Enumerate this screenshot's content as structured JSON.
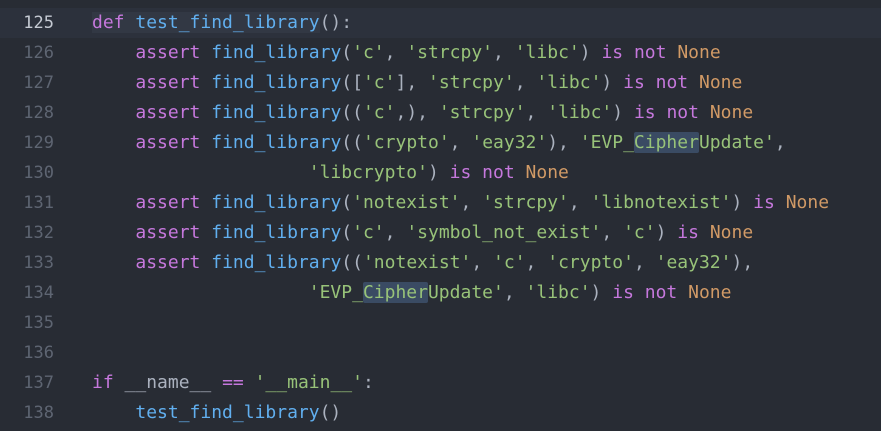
{
  "editor": {
    "lines": [
      {
        "number": "125",
        "tokens": [
          {
            "t": "def",
            "c": "kw"
          },
          {
            "t": " ",
            "c": "plain"
          },
          {
            "t": "test_find_library",
            "c": "fn"
          },
          {
            "t": "():",
            "c": "plain"
          }
        ]
      },
      {
        "number": "126",
        "tokens": [
          {
            "t": "    ",
            "c": "plain"
          },
          {
            "t": "assert",
            "c": "kw"
          },
          {
            "t": " ",
            "c": "plain"
          },
          {
            "t": "find_library",
            "c": "fn"
          },
          {
            "t": "(",
            "c": "plain"
          },
          {
            "t": "'c'",
            "c": "str"
          },
          {
            "t": ", ",
            "c": "plain"
          },
          {
            "t": "'strcpy'",
            "c": "str"
          },
          {
            "t": ", ",
            "c": "plain"
          },
          {
            "t": "'libc'",
            "c": "str"
          },
          {
            "t": ") ",
            "c": "plain"
          },
          {
            "t": "is not",
            "c": "kw"
          },
          {
            "t": " ",
            "c": "plain"
          },
          {
            "t": "None",
            "c": "const"
          }
        ]
      },
      {
        "number": "127",
        "tokens": [
          {
            "t": "    ",
            "c": "plain"
          },
          {
            "t": "assert",
            "c": "kw"
          },
          {
            "t": " ",
            "c": "plain"
          },
          {
            "t": "find_library",
            "c": "fn"
          },
          {
            "t": "([",
            "c": "plain"
          },
          {
            "t": "'c'",
            "c": "str"
          },
          {
            "t": "], ",
            "c": "plain"
          },
          {
            "t": "'strcpy'",
            "c": "str"
          },
          {
            "t": ", ",
            "c": "plain"
          },
          {
            "t": "'libc'",
            "c": "str"
          },
          {
            "t": ") ",
            "c": "plain"
          },
          {
            "t": "is not",
            "c": "kw"
          },
          {
            "t": " ",
            "c": "plain"
          },
          {
            "t": "None",
            "c": "const"
          }
        ]
      },
      {
        "number": "128",
        "tokens": [
          {
            "t": "    ",
            "c": "plain"
          },
          {
            "t": "assert",
            "c": "kw"
          },
          {
            "t": " ",
            "c": "plain"
          },
          {
            "t": "find_library",
            "c": "fn"
          },
          {
            "t": "((",
            "c": "plain"
          },
          {
            "t": "'c'",
            "c": "str"
          },
          {
            "t": ",), ",
            "c": "plain"
          },
          {
            "t": "'strcpy'",
            "c": "str"
          },
          {
            "t": ", ",
            "c": "plain"
          },
          {
            "t": "'libc'",
            "c": "str"
          },
          {
            "t": ") ",
            "c": "plain"
          },
          {
            "t": "is not",
            "c": "kw"
          },
          {
            "t": " ",
            "c": "plain"
          },
          {
            "t": "None",
            "c": "const"
          }
        ]
      },
      {
        "number": "129",
        "tokens": [
          {
            "t": "    ",
            "c": "plain"
          },
          {
            "t": "assert",
            "c": "kw"
          },
          {
            "t": " ",
            "c": "plain"
          },
          {
            "t": "find_library",
            "c": "fn"
          },
          {
            "t": "((",
            "c": "plain"
          },
          {
            "t": "'crypto'",
            "c": "str"
          },
          {
            "t": ", ",
            "c": "plain"
          },
          {
            "t": "'eay32'",
            "c": "str"
          },
          {
            "t": "), ",
            "c": "plain"
          },
          {
            "t": "'EVP_",
            "c": "str"
          },
          {
            "t": "Cipher",
            "c": "str",
            "sel": true
          },
          {
            "t": "Update'",
            "c": "str"
          },
          {
            "t": ",",
            "c": "plain"
          }
        ]
      },
      {
        "number": "130",
        "tokens": [
          {
            "t": "                    ",
            "c": "plain"
          },
          {
            "t": "'libcrypto'",
            "c": "str"
          },
          {
            "t": ") ",
            "c": "plain"
          },
          {
            "t": "is not",
            "c": "kw"
          },
          {
            "t": " ",
            "c": "plain"
          },
          {
            "t": "None",
            "c": "const"
          }
        ]
      },
      {
        "number": "131",
        "tokens": [
          {
            "t": "    ",
            "c": "plain"
          },
          {
            "t": "assert",
            "c": "kw"
          },
          {
            "t": " ",
            "c": "plain"
          },
          {
            "t": "find_library",
            "c": "fn"
          },
          {
            "t": "(",
            "c": "plain"
          },
          {
            "t": "'notexist'",
            "c": "str"
          },
          {
            "t": ", ",
            "c": "plain"
          },
          {
            "t": "'strcpy'",
            "c": "str"
          },
          {
            "t": ", ",
            "c": "plain"
          },
          {
            "t": "'libnotexist'",
            "c": "str"
          },
          {
            "t": ") ",
            "c": "plain"
          },
          {
            "t": "is",
            "c": "kw"
          },
          {
            "t": " ",
            "c": "plain"
          },
          {
            "t": "None",
            "c": "const"
          }
        ]
      },
      {
        "number": "132",
        "tokens": [
          {
            "t": "    ",
            "c": "plain"
          },
          {
            "t": "assert",
            "c": "kw"
          },
          {
            "t": " ",
            "c": "plain"
          },
          {
            "t": "find_library",
            "c": "fn"
          },
          {
            "t": "(",
            "c": "plain"
          },
          {
            "t": "'c'",
            "c": "str"
          },
          {
            "t": ", ",
            "c": "plain"
          },
          {
            "t": "'symbol_not_exist'",
            "c": "str"
          },
          {
            "t": ", ",
            "c": "plain"
          },
          {
            "t": "'c'",
            "c": "str"
          },
          {
            "t": ") ",
            "c": "plain"
          },
          {
            "t": "is",
            "c": "kw"
          },
          {
            "t": " ",
            "c": "plain"
          },
          {
            "t": "None",
            "c": "const"
          }
        ]
      },
      {
        "number": "133",
        "tokens": [
          {
            "t": "    ",
            "c": "plain"
          },
          {
            "t": "assert",
            "c": "kw"
          },
          {
            "t": " ",
            "c": "plain"
          },
          {
            "t": "find_library",
            "c": "fn"
          },
          {
            "t": "((",
            "c": "plain"
          },
          {
            "t": "'notexist'",
            "c": "str"
          },
          {
            "t": ", ",
            "c": "plain"
          },
          {
            "t": "'c'",
            "c": "str"
          },
          {
            "t": ", ",
            "c": "plain"
          },
          {
            "t": "'crypto'",
            "c": "str"
          },
          {
            "t": ", ",
            "c": "plain"
          },
          {
            "t": "'eay32'",
            "c": "str"
          },
          {
            "t": "),",
            "c": "plain"
          }
        ]
      },
      {
        "number": "134",
        "tokens": [
          {
            "t": "                    ",
            "c": "plain"
          },
          {
            "t": "'EVP_",
            "c": "str"
          },
          {
            "t": "Cipher",
            "c": "str",
            "sel": true
          },
          {
            "t": "Update'",
            "c": "str"
          },
          {
            "t": ", ",
            "c": "plain"
          },
          {
            "t": "'libc'",
            "c": "str"
          },
          {
            "t": ") ",
            "c": "plain"
          },
          {
            "t": "is not",
            "c": "kw"
          },
          {
            "t": " ",
            "c": "plain"
          },
          {
            "t": "None",
            "c": "const"
          }
        ]
      },
      {
        "number": "135",
        "tokens": []
      },
      {
        "number": "136",
        "tokens": []
      },
      {
        "number": "137",
        "tokens": [
          {
            "t": "if",
            "c": "kw"
          },
          {
            "t": " __name__ ",
            "c": "plain"
          },
          {
            "t": "==",
            "c": "kw"
          },
          {
            "t": " ",
            "c": "plain"
          },
          {
            "t": "'__main__'",
            "c": "str"
          },
          {
            "t": ":",
            "c": "plain"
          }
        ]
      },
      {
        "number": "138",
        "tokens": [
          {
            "t": "    ",
            "c": "plain"
          },
          {
            "t": "test_find_library",
            "c": "fn"
          },
          {
            "t": "()",
            "c": "plain"
          }
        ]
      }
    ]
  }
}
